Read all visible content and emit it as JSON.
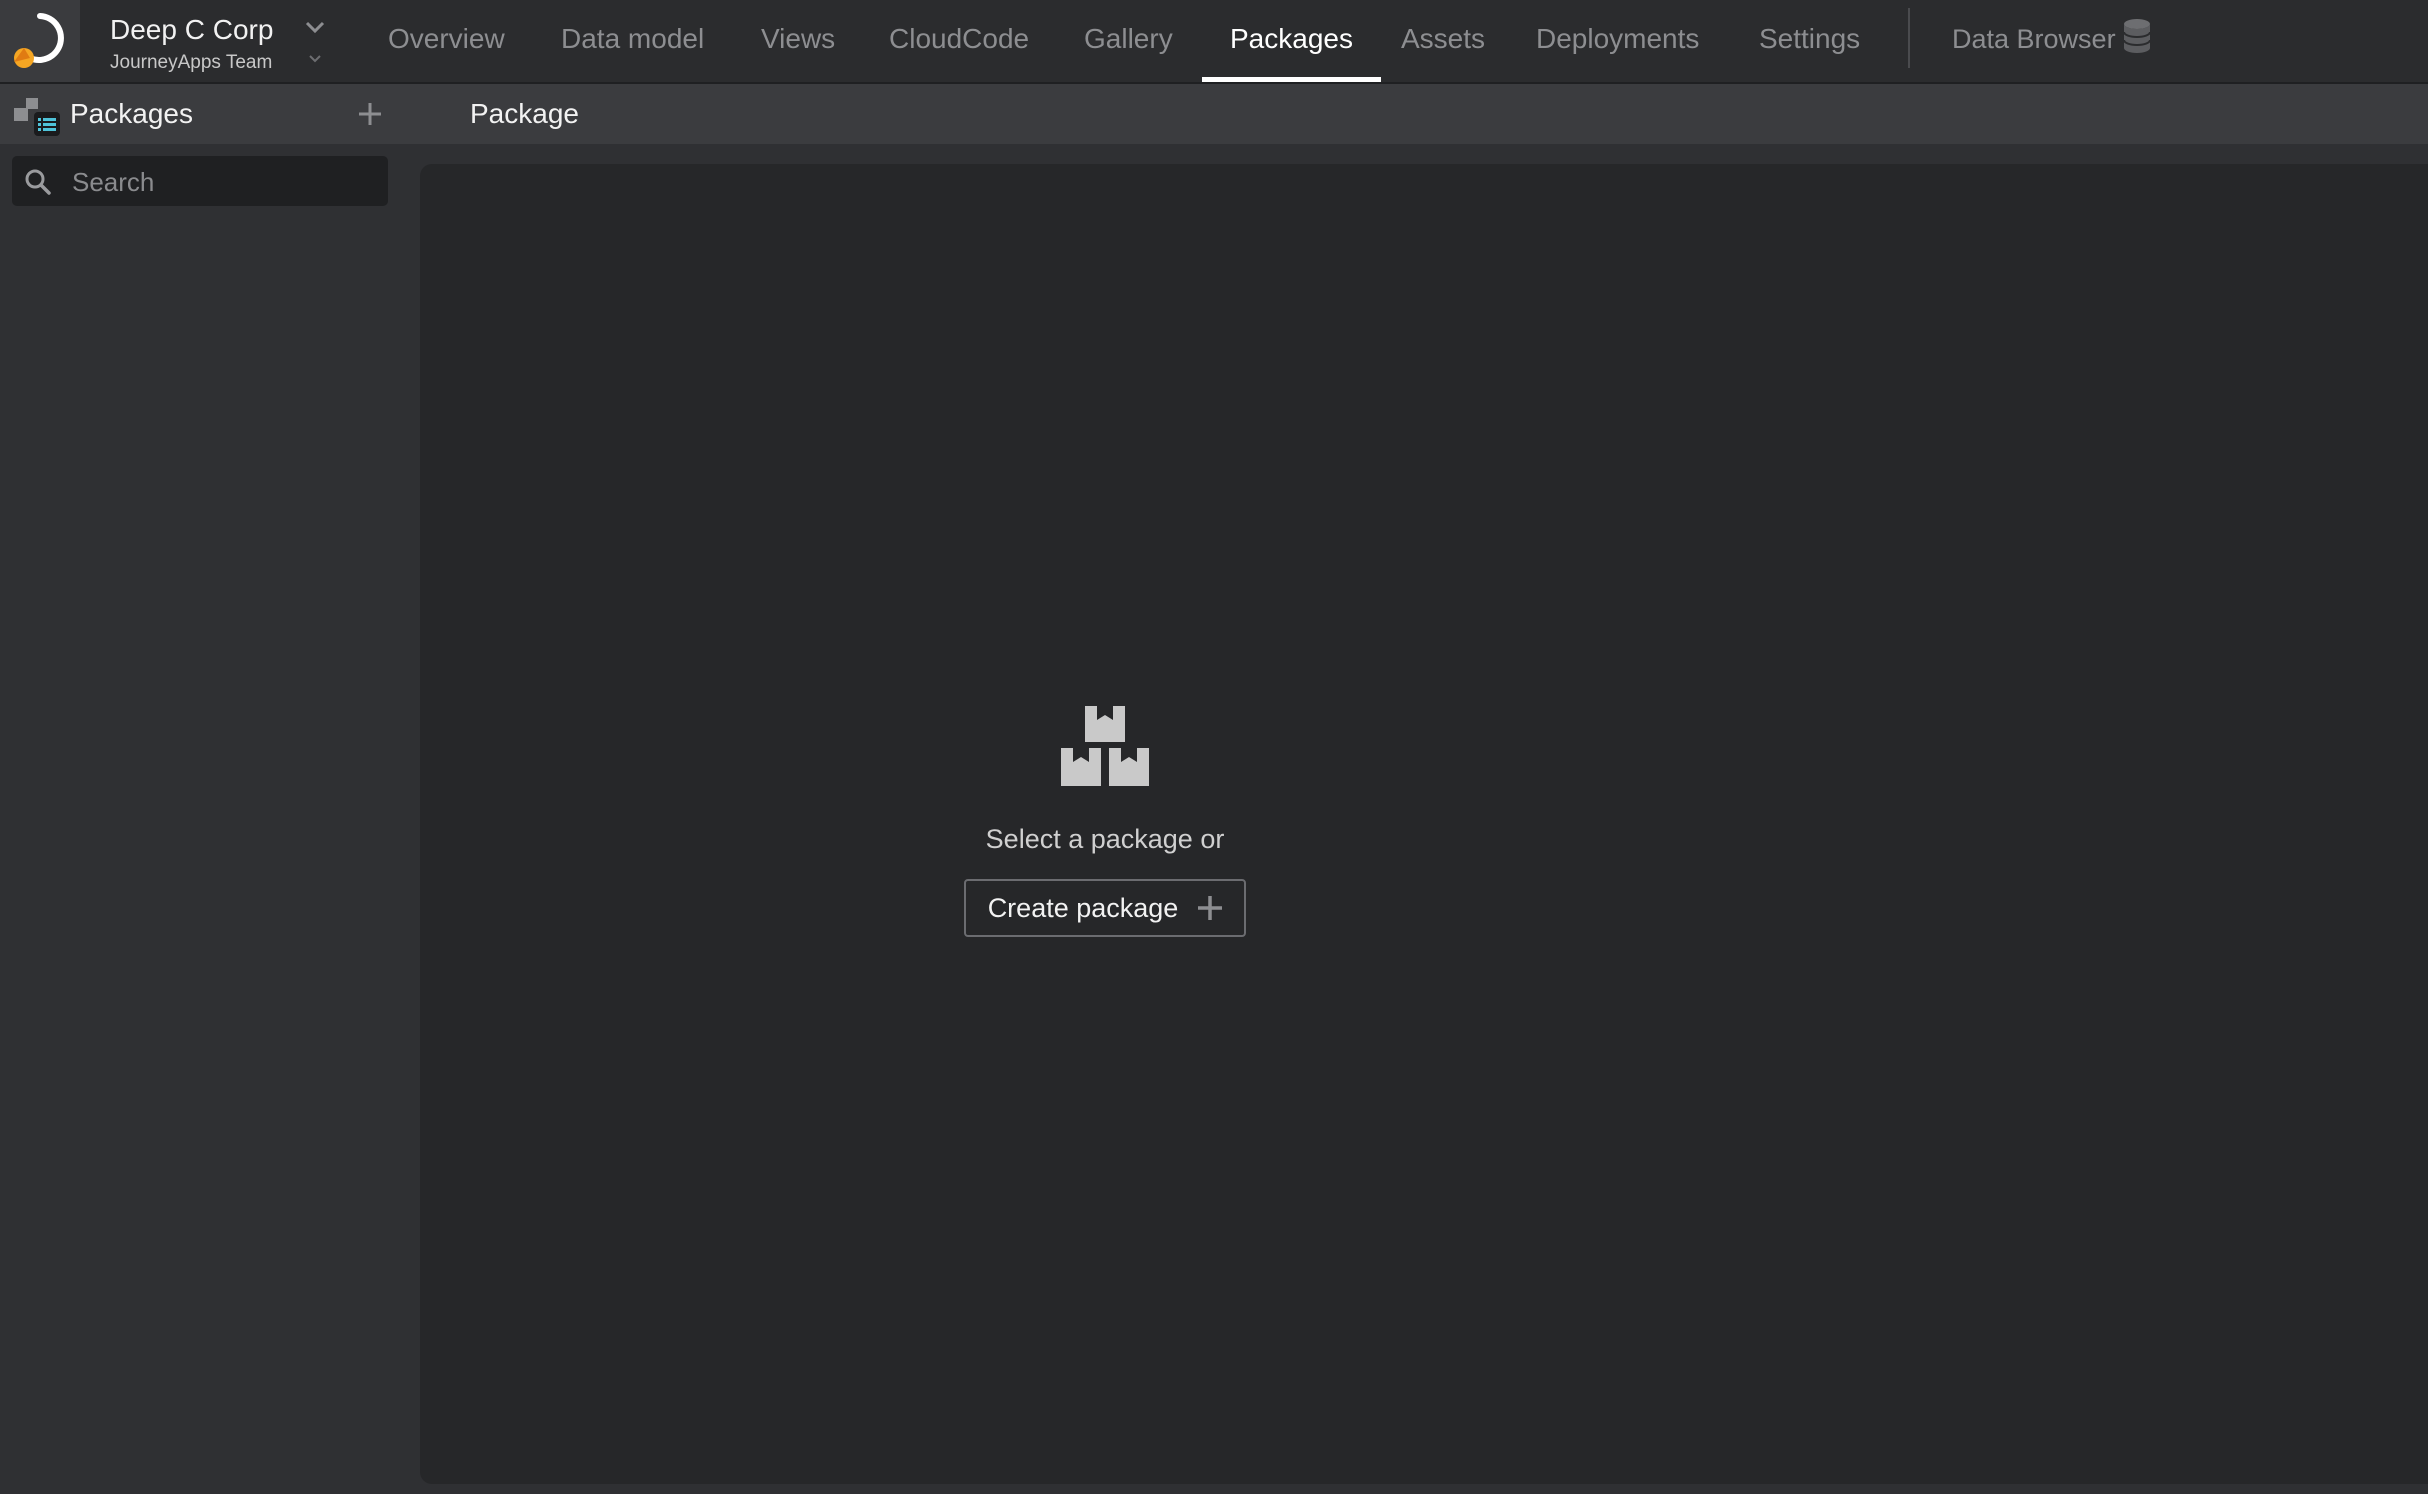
{
  "org": {
    "name": "Deep C Corp",
    "team": "JourneyApps Team"
  },
  "nav": {
    "tabs": [
      {
        "label": "Overview"
      },
      {
        "label": "Data model"
      },
      {
        "label": "Views"
      },
      {
        "label": "CloudCode"
      },
      {
        "label": "Gallery"
      },
      {
        "label": "Packages",
        "active": true
      },
      {
        "label": "Assets"
      },
      {
        "label": "Deployments"
      },
      {
        "label": "Settings"
      }
    ],
    "data_browser_label": "Data Browser"
  },
  "sidebar": {
    "title": "Packages",
    "search_placeholder": "Search"
  },
  "main": {
    "title": "Package",
    "empty_text": "Select a package or",
    "create_label": "Create package"
  },
  "colors": {
    "background": "#2f3033",
    "panel": "#262729",
    "accent_orange": "#f5a623",
    "active_tab": "#ffffff",
    "inactive_tab": "#8d8e91"
  }
}
